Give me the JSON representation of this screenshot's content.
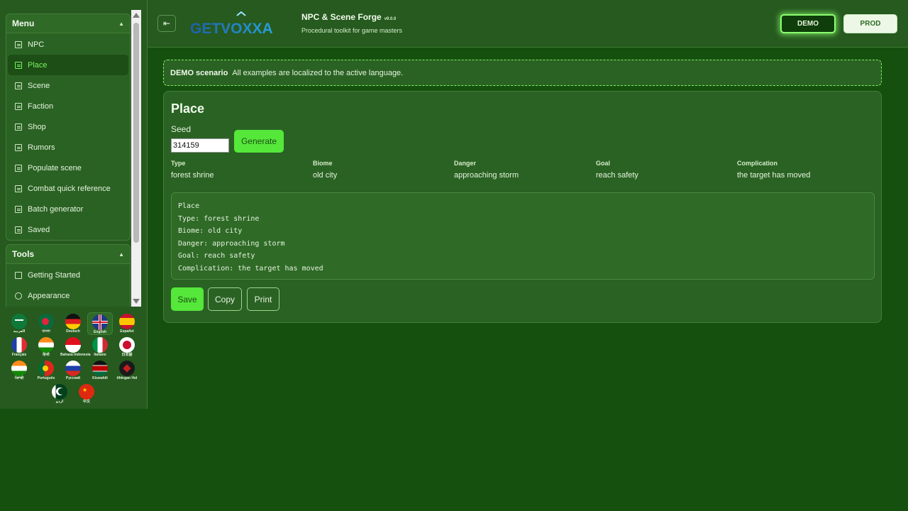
{
  "sidebar": {
    "menu_title": "Menu",
    "menu_items": [
      {
        "label": "NPC"
      },
      {
        "label": "Place",
        "active": true
      },
      {
        "label": "Scene"
      },
      {
        "label": "Faction"
      },
      {
        "label": "Shop"
      },
      {
        "label": "Rumors"
      },
      {
        "label": "Populate scene"
      },
      {
        "label": "Combat quick reference"
      },
      {
        "label": "Batch generator"
      },
      {
        "label": "Saved"
      }
    ],
    "tools_title": "Tools",
    "tools_items": [
      {
        "label": "Getting Started",
        "icon": "flag-icon"
      },
      {
        "label": "Appearance",
        "icon": "palette-icon"
      }
    ],
    "languages": [
      {
        "label": "العربية",
        "code": "ar"
      },
      {
        "label": "বাংলা",
        "code": "bn"
      },
      {
        "label": "Deutsch",
        "code": "de"
      },
      {
        "label": "English",
        "code": "en",
        "selected": true
      },
      {
        "label": "Español",
        "code": "es"
      },
      {
        "label": "Français",
        "code": "fr"
      },
      {
        "label": "हिन्दी",
        "code": "hi"
      },
      {
        "label": "Bahasa Indonesia",
        "code": "id"
      },
      {
        "label": "Italiano",
        "code": "it"
      },
      {
        "label": "日本語",
        "code": "ja"
      },
      {
        "label": "ਪੰਜਾਬੀ",
        "code": "pa"
      },
      {
        "label": "Português",
        "code": "pt"
      },
      {
        "label": "Русский",
        "code": "ru"
      },
      {
        "label": "Kiswahili",
        "code": "sw"
      },
      {
        "label": "tlhIngan Hol",
        "code": "tlh"
      },
      {
        "label": "اردو",
        "code": "ur"
      },
      {
        "label": "中文",
        "code": "zh"
      }
    ]
  },
  "header": {
    "logo_text": "GETVOXXA",
    "title": "NPC & Scene Forge",
    "version": "v9.0.0",
    "subtitle": "Procedural toolkit for game masters",
    "demo_label": "DEMO",
    "prod_label": "PROD"
  },
  "banner": {
    "strong": "DEMO scenario",
    "text": "All examples are localized to the active language."
  },
  "card": {
    "title": "Place",
    "seed_label": "Seed",
    "seed_value": "314159",
    "generate_label": "Generate",
    "attributes": [
      {
        "key": "Type",
        "value": "forest shrine"
      },
      {
        "key": "Biome",
        "value": "old city"
      },
      {
        "key": "Danger",
        "value": "approaching storm"
      },
      {
        "key": "Goal",
        "value": "reach safety"
      },
      {
        "key": "Complication",
        "value": "the target has moved"
      }
    ],
    "output_lines": [
      "Place",
      "Type: forest shrine",
      "Biome: old city",
      "Danger: approaching storm",
      "Goal: reach safety",
      "Complication: the target has moved"
    ],
    "save_label": "Save",
    "copy_label": "Copy",
    "print_label": "Print"
  },
  "colors": {
    "accent": "#55e83a",
    "background": "#16500f",
    "panel": "#2a6223"
  }
}
